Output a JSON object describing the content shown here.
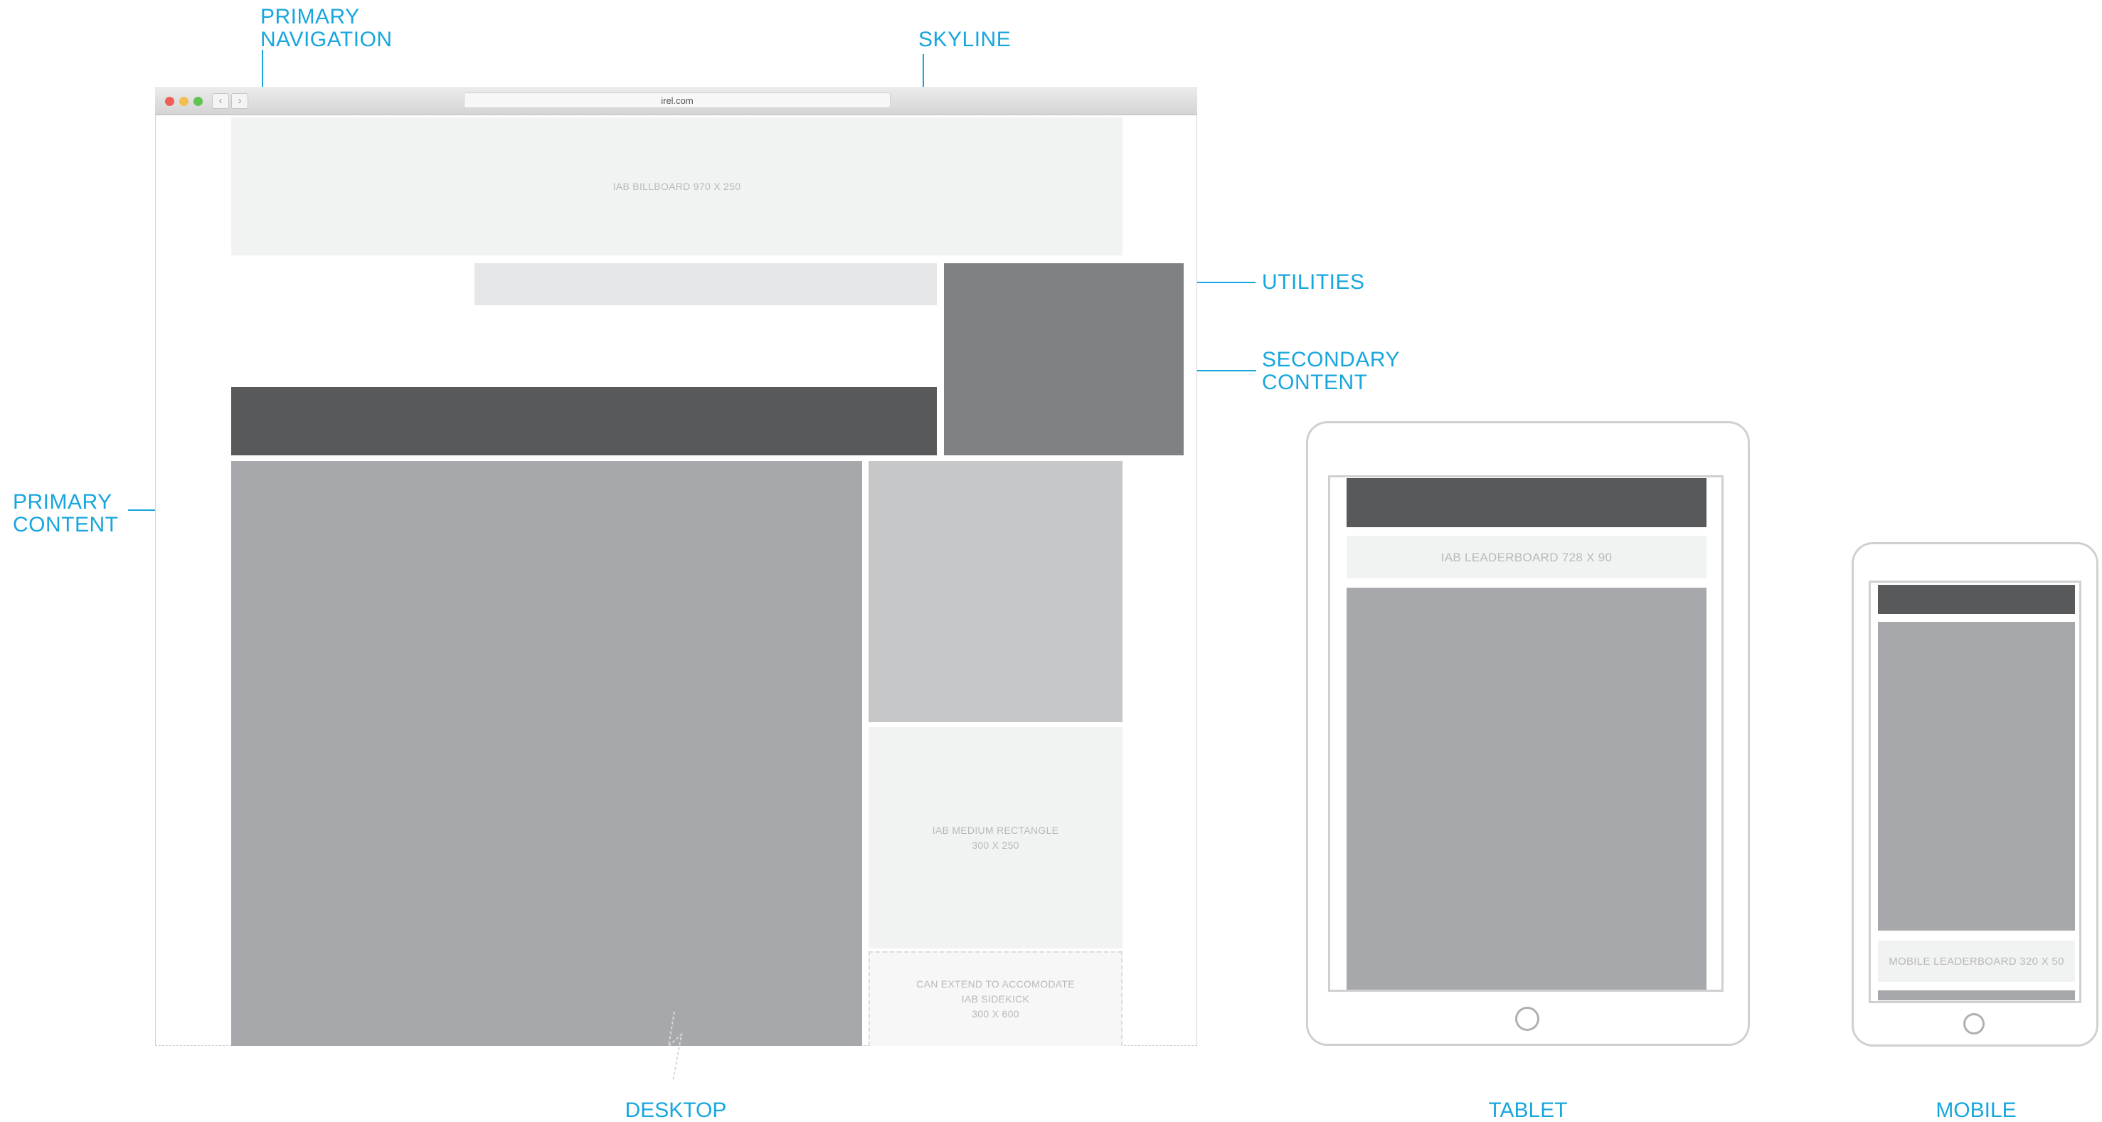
{
  "callouts": {
    "primary_navigation": [
      "PRIMARY",
      "NAVIGATION"
    ],
    "skyline": "SKYLINE",
    "utilities": "UTILITIES",
    "secondary_content": [
      "SECONDARY",
      "CONTENT"
    ],
    "primary_content": [
      "PRIMARY",
      "CONTENT"
    ]
  },
  "browser": {
    "url": "irel.com",
    "back_glyph": "‹",
    "forward_glyph": "›",
    "traffic_light_colors": [
      "#ee5e56",
      "#f4bd4f",
      "#5fc454"
    ]
  },
  "desktop": {
    "billboard_label": "IAB BILLBOARD 970 X 250",
    "medium_rectangle_label": [
      "IAB MEDIUM RECTANGLE",
      "300 X 250"
    ],
    "sidekick_label": [
      "CAN EXTEND TO ACCOMODATE",
      "IAB SIDEKICK",
      "300 X 600"
    ]
  },
  "tablet": {
    "leaderboard_label": "IAB LEADERBOARD 728 X 90"
  },
  "mobile": {
    "leaderboard_label": "MOBILE LEADERBOARD 320 X 50"
  },
  "device_labels": {
    "desktop": "DESKTOP",
    "tablet": "TABLET",
    "mobile": "MOBILE"
  },
  "colors": {
    "accent": "#17a6dd",
    "nav_dark": "#58595b",
    "utilities": "#808184",
    "primary_content": "#a7a8ab",
    "secondary_content": "#c6c7c8",
    "ad_light": "#f1f2f2",
    "skyline": "#e6e7e8"
  }
}
